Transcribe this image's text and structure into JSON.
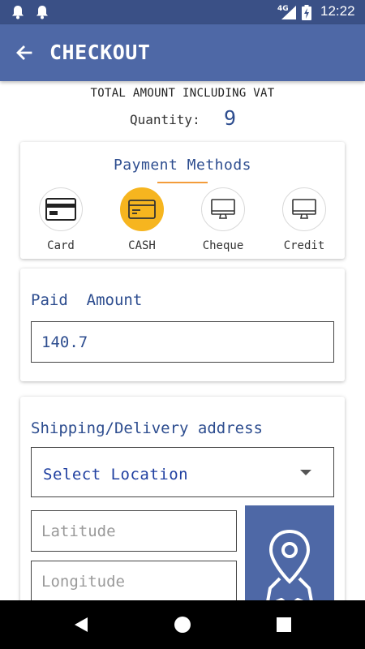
{
  "status_bar": {
    "network": "4G",
    "time": "12:22"
  },
  "app_bar": {
    "title": "CHECKOUT"
  },
  "summary": {
    "total_label": "TOTAL AMOUNT INCLUDING VAT",
    "quantity_label": "Quantity:",
    "quantity_value": "9"
  },
  "payment_methods": {
    "title": "Payment Methods",
    "selected": "CASH",
    "items": [
      {
        "label": "Card",
        "icon": "credit-card-icon"
      },
      {
        "label": "CASH",
        "icon": "cash-card-icon"
      },
      {
        "label": "Cheque",
        "icon": "monitor-icon"
      },
      {
        "label": "Credit",
        "icon": "monitor-icon"
      }
    ]
  },
  "paid_amount": {
    "label": "Paid  Amount",
    "value": "140.7"
  },
  "shipping": {
    "label": "Shipping/Delivery address",
    "select_value": "Select Location",
    "latitude_placeholder": "Latitude",
    "longitude_placeholder": "Longitude",
    "map_button_icon": "map-pin-icon"
  },
  "colors": {
    "status_bar": "#3a5086",
    "app_bar": "#4e68a6",
    "accent": "#2d4d8f",
    "selected_method": "#f6b51f",
    "underline": "#f39c3b"
  }
}
